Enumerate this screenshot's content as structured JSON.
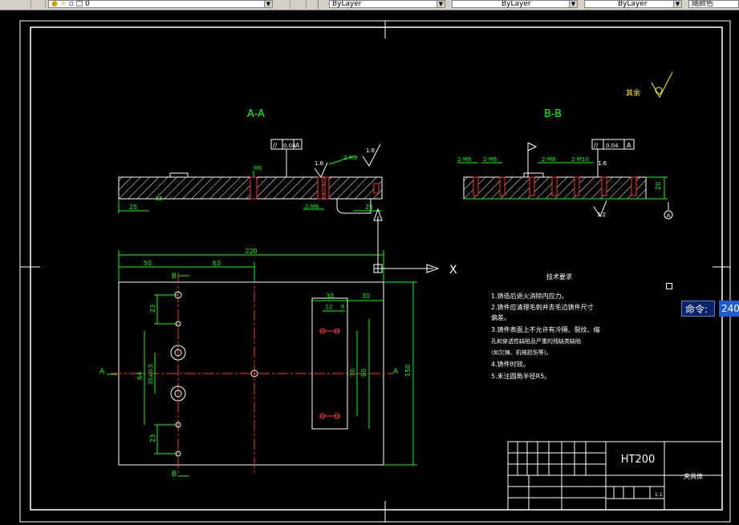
{
  "toolbar": {
    "layer_value": "0",
    "color_value": "ByLayer",
    "linetype_value": "ByLayer",
    "lineweight_value": "ByLayer",
    "plotstyle_label": "随颜色"
  },
  "drawing": {
    "section_aa_label": "A-A",
    "section_bb_label": "B-B",
    "roughness_note": "其余",
    "material": "HT200",
    "part_name": "夹具体",
    "scale_cell": "1:1",
    "tolerance_flatness": "0.04",
    "datum_a": "A",
    "tech_req_title": "技术要求",
    "tech_req": [
      "1.铸造后退火消除内应力。",
      "2.铸件应清理毛刺并去毛边铸件尺寸",
      "偏差。",
      "3.铸件表面上不允许有冷隔、裂纹、缩",
      "孔和穿透性缺陷及严重的残缺类缺陷",
      "(如欠铸、机械损伤等)。",
      "4.铸件时效。",
      "5.未注圆角半径R5。"
    ],
    "dims": {
      "d220": "220",
      "d50": "50",
      "d63": "63",
      "d30a": "30",
      "d30b": "30",
      "d12": "12",
      "d9": "9",
      "d23a": "23",
      "d23b": "23",
      "d64": "64",
      "d35": "35±0.5",
      "d70": "70",
      "d90": "90",
      "d150": "150",
      "d25a": "25",
      "d25b": "25",
      "d20": "20",
      "d32": "3.2",
      "d16": "1.6",
      "d16b": "1.6",
      "m6": "2-M6",
      "m6b": "2-M6",
      "m8": "2-M8",
      "m8b": "2-M8",
      "m10": "2-M10",
      "m6c": "2-M6",
      "m6d": "2-M6",
      "d15": "15",
      "d6": "M6"
    },
    "marks": {
      "A_left": "A",
      "A_right": "A",
      "B_top": "B",
      "B_bottom": "B",
      "ucs_x": "X"
    }
  },
  "command": {
    "label": "命令:",
    "value": "240"
  }
}
